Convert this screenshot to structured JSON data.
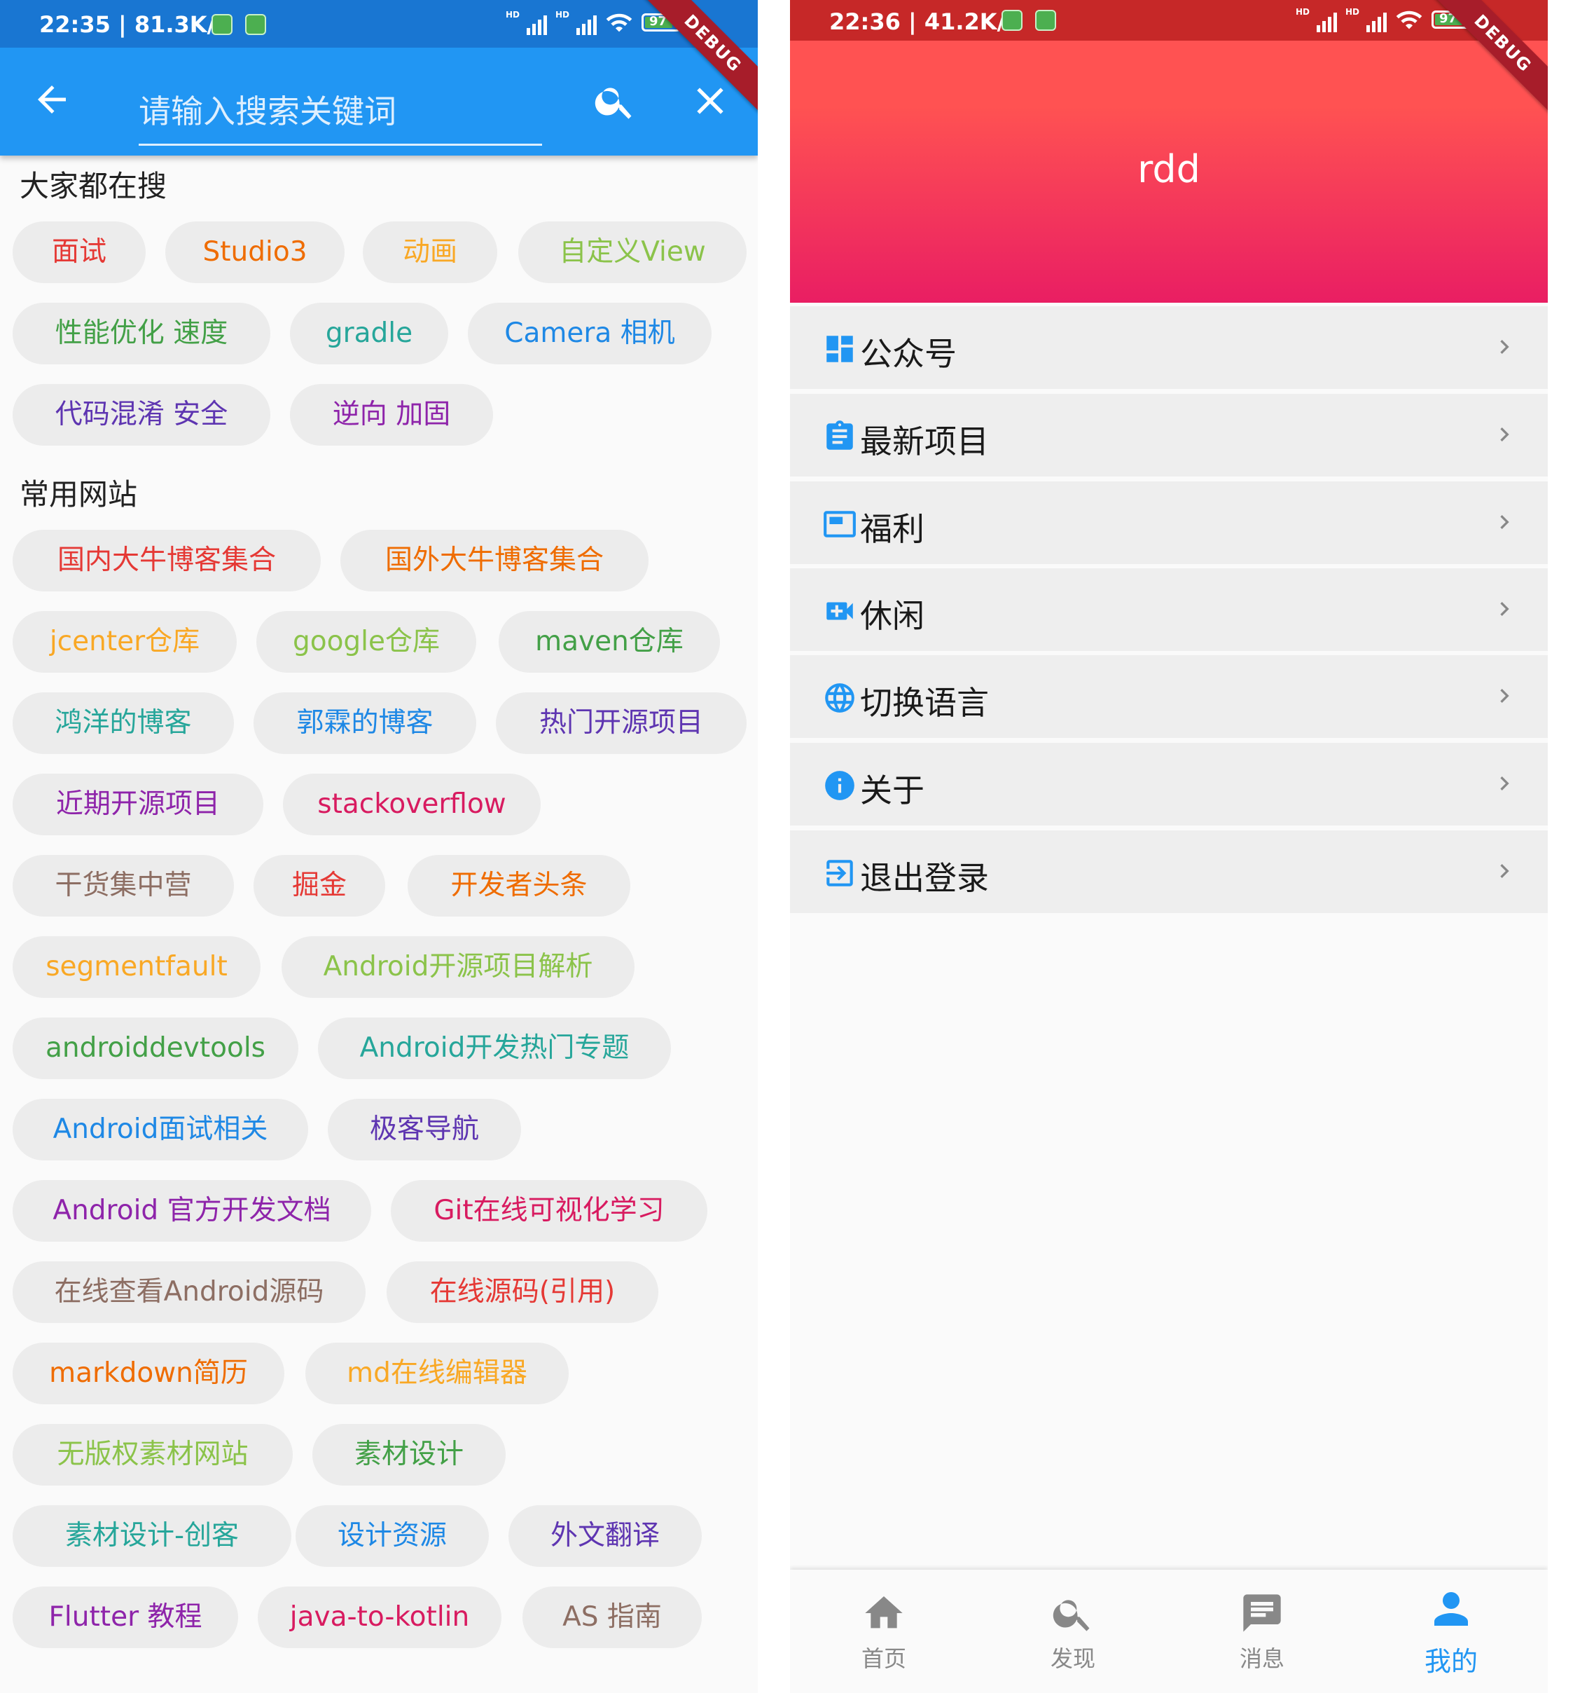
{
  "left": {
    "status": {
      "time_speed": "22:35 | 81.3K/s",
      "battery": "97"
    },
    "debug_label": "DEBUG",
    "search": {
      "placeholder": "请输入搜索关键词"
    },
    "hot_title": "大家都在搜",
    "hot": [
      {
        "label": "面试",
        "color": "#e53935"
      },
      {
        "label": "Studio3",
        "color": "#ef6c00"
      },
      {
        "label": "动画",
        "color": "#f9a825"
      },
      {
        "label": "自定义View",
        "color": "#8bc34a"
      },
      {
        "label": "性能优化 速度",
        "color": "#43a047"
      },
      {
        "label": "gradle",
        "color": "#26a69a"
      },
      {
        "label": "Camera 相机",
        "color": "#1e88e5"
      },
      {
        "label": "代码混淆 安全",
        "color": "#5e35b1"
      },
      {
        "label": "逆向 加固",
        "color": "#8e24aa"
      }
    ],
    "sites_title": "常用网站",
    "sites": [
      {
        "label": "国内大牛博客集合",
        "color": "#e53935"
      },
      {
        "label": "国外大牛博客集合",
        "color": "#ef6c00"
      },
      {
        "label": "jcenter仓库",
        "color": "#f9a825"
      },
      {
        "label": "google仓库",
        "color": "#8bc34a"
      },
      {
        "label": "maven仓库",
        "color": "#43a047"
      },
      {
        "label": "鸿洋的博客",
        "color": "#26a69a"
      },
      {
        "label": "郭霖的博客",
        "color": "#1e88e5"
      },
      {
        "label": "热门开源项目",
        "color": "#5e35b1"
      },
      {
        "label": "近期开源项目",
        "color": "#8e24aa"
      },
      {
        "label": "stackoverflow",
        "color": "#d81b60"
      },
      {
        "label": "干货集中营",
        "color": "#8d6e63"
      },
      {
        "label": "掘金",
        "color": "#e53935"
      },
      {
        "label": "开发者头条",
        "color": "#ef6c00"
      },
      {
        "label": "segmentfault",
        "color": "#f9a825"
      },
      {
        "label": "Android开源项目解析",
        "color": "#8bc34a"
      },
      {
        "label": "androiddevtools",
        "color": "#43a047"
      },
      {
        "label": "Android开发热门专题",
        "color": "#26a69a"
      },
      {
        "label": "Android面试相关",
        "color": "#1e88e5"
      },
      {
        "label": "极客导航",
        "color": "#5e35b1"
      },
      {
        "label": "Android 官方开发文档",
        "color": "#8e24aa"
      },
      {
        "label": "Git在线可视化学习",
        "color": "#d81b60"
      },
      {
        "label": "在线查看Android源码",
        "color": "#8d6e63"
      },
      {
        "label": "在线源码(引用)",
        "color": "#e53935"
      },
      {
        "label": "markdown简历",
        "color": "#ef6c00"
      },
      {
        "label": "md在线编辑器",
        "color": "#f9a825"
      },
      {
        "label": "无版权素材网站",
        "color": "#8bc34a"
      },
      {
        "label": "素材设计",
        "color": "#43a047"
      },
      {
        "label": "素材设计-创客",
        "color": "#26a69a"
      },
      {
        "label": "设计资源",
        "color": "#1e88e5"
      },
      {
        "label": "外文翻译",
        "color": "#5e35b1"
      },
      {
        "label": "Flutter 教程",
        "color": "#8e24aa"
      },
      {
        "label": "java-to-kotlin",
        "color": "#d81b60"
      },
      {
        "label": "AS 指南",
        "color": "#8d6e63"
      }
    ]
  },
  "right": {
    "status": {
      "time_speed": "22:36 | 41.2K/s",
      "battery": "97"
    },
    "debug_label": "DEBUG",
    "profile_name": "rdd",
    "menu": [
      {
        "label": "公众号",
        "icon": "dashboard-icon"
      },
      {
        "label": "最新项目",
        "icon": "clipboard-icon"
      },
      {
        "label": "福利",
        "icon": "featured-video-icon"
      },
      {
        "label": "休闲",
        "icon": "video-call-icon"
      },
      {
        "label": "切换语言",
        "icon": "globe-icon"
      },
      {
        "label": "关于",
        "icon": "info-icon"
      },
      {
        "label": "退出登录",
        "icon": "exit-icon"
      }
    ],
    "nav": [
      {
        "label": "首页",
        "icon": "home-icon"
      },
      {
        "label": "发现",
        "icon": "search-icon"
      },
      {
        "label": "消息",
        "icon": "message-icon"
      },
      {
        "label": "我的",
        "icon": "person-icon",
        "active": true
      }
    ],
    "accent": "#2196f3"
  }
}
